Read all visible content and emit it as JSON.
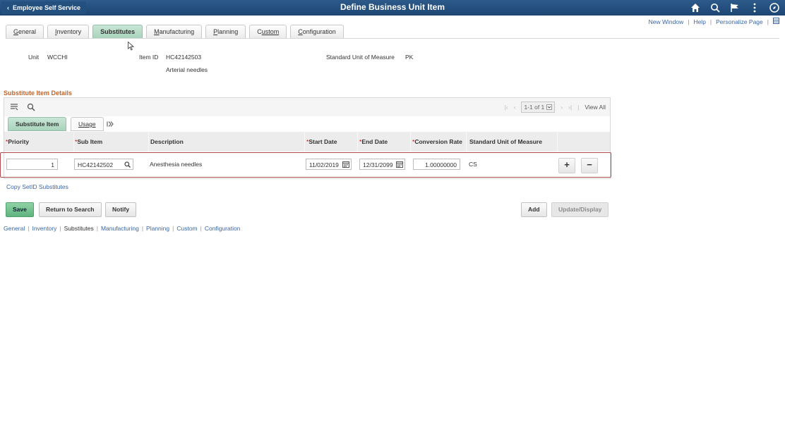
{
  "header": {
    "back_label": "Employee Self Service",
    "title": "Define Business Unit Item",
    "icons": [
      "home-icon",
      "search-icon",
      "flag-icon",
      "more-vertical-icon",
      "navigator-icon"
    ]
  },
  "links": {
    "new_window": "New Window",
    "help": "Help",
    "personalize": "Personalize Page"
  },
  "tabs": [
    {
      "label": "General",
      "key": "G",
      "rest": "eneral"
    },
    {
      "label": "Inventory",
      "key": "I",
      "rest": "nventory"
    },
    {
      "label": "Substitutes",
      "active": true
    },
    {
      "label": "Manufacturing",
      "key": "M",
      "rest": "anufacturing"
    },
    {
      "label": "Planning",
      "key": "P",
      "rest": "lanning"
    },
    {
      "label": "Custom",
      "key": "C",
      "rest": "ustom"
    },
    {
      "label": "Configuration",
      "key": "C",
      "rest": "onfiguration"
    }
  ],
  "info": {
    "unit_label": "Unit",
    "unit_value": "WCCHI",
    "item_id_label": "Item ID",
    "item_id_value": "HC42142503",
    "item_desc": "Arterial needles",
    "uom_label": "Standard Unit of Measure",
    "uom_value": "PK"
  },
  "section": {
    "title": "Substitute Item Details",
    "pager": "1-1 of 1",
    "view_all": "View All",
    "subtabs": {
      "substitute_item": "Substitute Item",
      "usage": "Usage"
    }
  },
  "columns": {
    "priority": "Priority",
    "sub_item": "Sub Item",
    "description": "Description",
    "start_date": "Start Date",
    "end_date": "End Date",
    "conversion_rate": "Conversion Rate",
    "std_uom": "Standard Unit of Measure"
  },
  "row": {
    "priority": "1",
    "sub_item": "HC42142502",
    "description": "Anesthesia needles",
    "start_date": "11/02/2019",
    "end_date": "12/31/2099",
    "conversion_rate": "1.00000000",
    "std_uom": "CS"
  },
  "copy_link": "Copy SetID Substitutes",
  "buttons": {
    "save": "Save",
    "return": "Return to Search",
    "notify": "Notify",
    "add": "Add",
    "update": "Update/Display"
  },
  "footer": {
    "general": "General",
    "inventory": "Inventory",
    "substitutes": "Substitutes",
    "manufacturing": "Manufacturing",
    "planning": "Planning",
    "custom": "Custom",
    "configuration": "Configuration"
  }
}
